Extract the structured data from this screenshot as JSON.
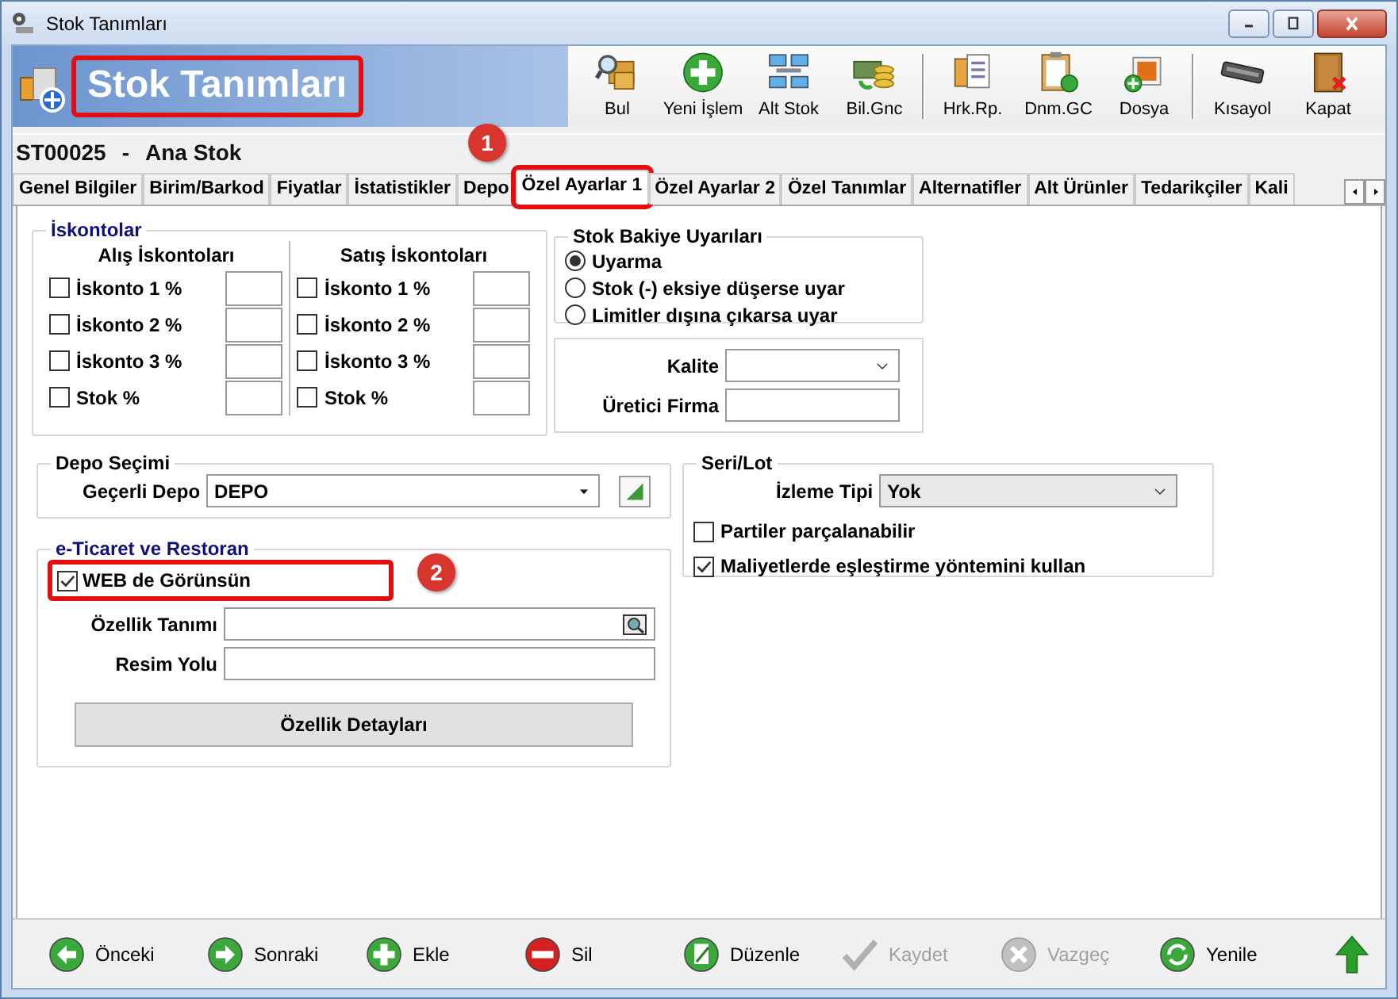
{
  "window": {
    "title": "Stok Tanımları"
  },
  "header": {
    "title": "Stok Tanımları",
    "highlighted": true
  },
  "toolbar_groups": [
    [
      {
        "label": "Bul"
      },
      {
        "label": "Yeni İşlem"
      },
      {
        "label": "Alt Stok"
      },
      {
        "label": "Bil.Gnc"
      }
    ],
    [
      {
        "label": "Hrk.Rp."
      },
      {
        "label": "Dnm.GC"
      },
      {
        "label": "Dosya"
      }
    ],
    [
      {
        "label": "Kısayol"
      },
      {
        "label": "Kapat"
      }
    ]
  ],
  "record": {
    "code": "ST00025",
    "separator": "-",
    "name": "Ana Stok"
  },
  "tabs": [
    {
      "label": "Genel Bilgiler",
      "selected": false
    },
    {
      "label": "Birim/Barkod",
      "selected": false
    },
    {
      "label": "Fiyatlar",
      "selected": false
    },
    {
      "label": "İstatistikler",
      "selected": false
    },
    {
      "label": "Depo",
      "selected": false
    },
    {
      "label": "Özel Ayarlar 1",
      "selected": true,
      "highlighted": true,
      "callout": "1"
    },
    {
      "label": "Özel Ayarlar 2",
      "selected": false
    },
    {
      "label": "Özel Tanımlar",
      "selected": false
    },
    {
      "label": "Alternatifler",
      "selected": false
    },
    {
      "label": "Alt Ürünler",
      "selected": false
    },
    {
      "label": "Tedarikçiler",
      "selected": false
    },
    {
      "label": "Kali",
      "selected": false
    }
  ],
  "discounts": {
    "title": "İskontolar",
    "columns": [
      {
        "title": "Alış İskontoları",
        "rows": [
          {
            "label": "İskonto 1 %",
            "checked": false
          },
          {
            "label": "İskonto 2 %",
            "checked": false
          },
          {
            "label": "İskonto 3 %",
            "checked": false
          },
          {
            "label": "Stok %",
            "checked": false
          }
        ]
      },
      {
        "title": "Satış İskontoları",
        "rows": [
          {
            "label": "İskonto 1 %",
            "checked": false
          },
          {
            "label": "İskonto 2 %",
            "checked": false
          },
          {
            "label": "İskonto 3 %",
            "checked": false
          },
          {
            "label": "Stok %",
            "checked": false
          }
        ]
      }
    ]
  },
  "stock_warnings": {
    "title": "Stok Bakiye Uyarıları",
    "options": [
      {
        "label": "Uyarma",
        "selected": true
      },
      {
        "label": "Stok (-) eksiye düşerse uyar",
        "selected": false
      },
      {
        "label": "Limitler dışına çıkarsa uyar",
        "selected": false
      }
    ]
  },
  "quality_fields": [
    {
      "label": "Kalite",
      "kind": "dropdown"
    },
    {
      "label": "Üretici Firma",
      "kind": "text"
    }
  ],
  "warehouse": {
    "title": "Depo Seçimi",
    "label": "Geçerli Depo",
    "value": "DEPO"
  },
  "ecommerce": {
    "title": "e-Ticaret ve Restoran",
    "web": {
      "label": "WEB de Görünsün",
      "checked": true,
      "highlighted": true,
      "callout": "2"
    },
    "fields": [
      {
        "label": "Özellik Tanımı",
        "kind": "lookup"
      },
      {
        "label": "Resim Yolu",
        "kind": "text"
      }
    ],
    "button": "Özellik Detayları"
  },
  "lot": {
    "title": "Seri/Lot",
    "label": "İzleme Tipi",
    "value": "Yok",
    "options": [
      {
        "label": "Partiler parçalanabilir",
        "checked": false
      },
      {
        "label": "Maliyetlerde eşleştirme yöntemini kullan",
        "checked": true
      }
    ]
  },
  "footer": [
    {
      "label": "Önceki",
      "disabled": false
    },
    {
      "label": "Sonraki",
      "disabled": false
    },
    {
      "label": "Ekle",
      "disabled": false
    },
    {
      "label": "Sil",
      "disabled": false
    },
    {
      "label": "Düzenle",
      "disabled": false
    },
    {
      "label": "Kaydet",
      "disabled": true
    },
    {
      "label": "Vazgeç",
      "disabled": true
    },
    {
      "label": "Yenile",
      "disabled": false
    }
  ]
}
